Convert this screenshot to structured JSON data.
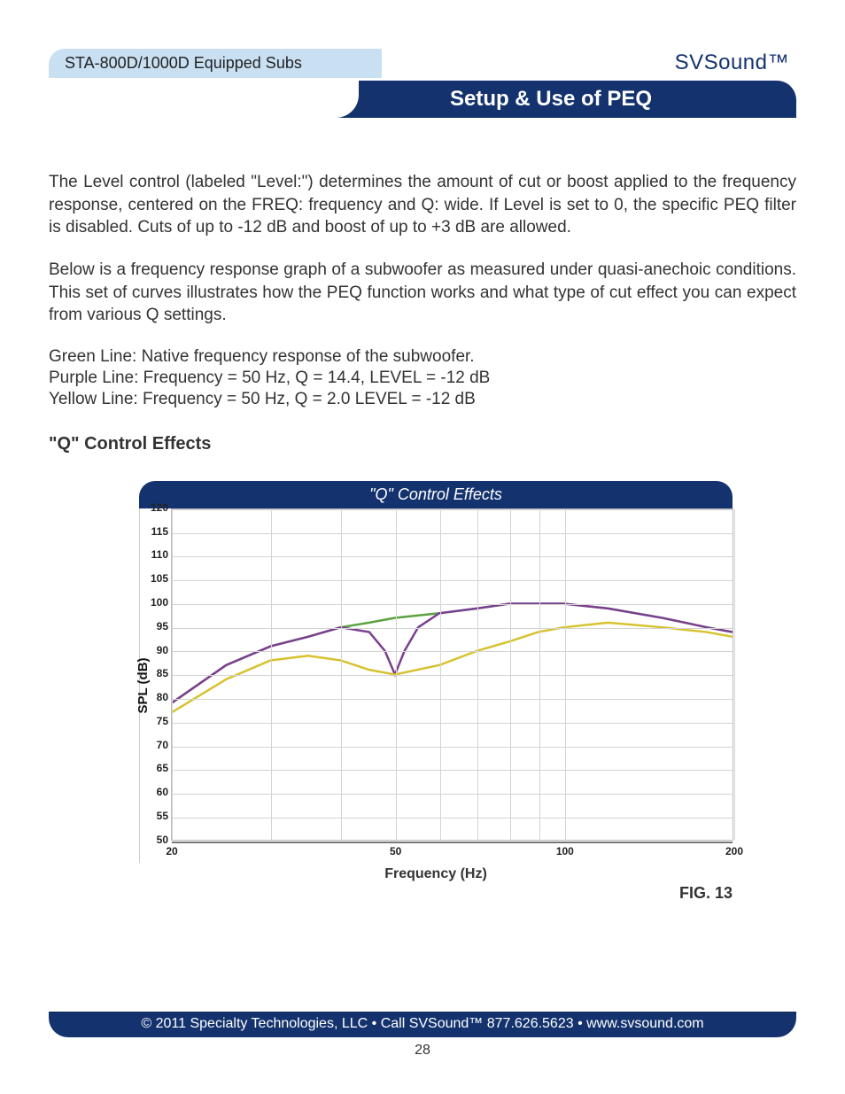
{
  "header": {
    "left_pill": "STA-800D/1000D Equipped Subs",
    "brand": "SVSound™",
    "section_title": "Setup & Use of PEQ"
  },
  "body": {
    "p1": "The Level control (labeled \"Level:\") determines the amount of cut or boost applied to the frequency response, centered on the FREQ: frequency and Q: wide. If Level is set to 0, the specific PEQ filter is disabled. Cuts of up to -12 dB and boost of up to +3 dB are allowed.",
    "p2": "Below is a frequency response graph of a subwoofer as measured under quasi-anechoic conditions. This set of curves illustrates how the PEQ function works and what type of cut effect you can expect from various Q settings.",
    "l1": "Green Line: Native frequency response of the subwoofer.",
    "l2": "Purple Line: Frequency = 50 Hz, Q = 14.4, LEVEL = -12 dB",
    "l3": "Yellow Line: Frequency = 50 Hz, Q = 2.0 LEVEL = -12 dB",
    "h3": "\"Q\" Control Effects"
  },
  "chart_data": {
    "type": "line",
    "title": "\"Q\" Control Effects",
    "xlabel": "Frequency (Hz)",
    "ylabel": "SPL (dB)",
    "xscale": "log",
    "xlim": [
      20,
      200
    ],
    "ylim": [
      50,
      120
    ],
    "yticks": [
      50,
      55,
      60,
      65,
      70,
      75,
      80,
      85,
      90,
      95,
      100,
      105,
      110,
      115,
      120
    ],
    "xticks": [
      20,
      50,
      100,
      200
    ],
    "series": [
      {
        "name": "Green — Native response",
        "color": "#5aa341",
        "x": [
          20,
          25,
          30,
          35,
          40,
          45,
          50,
          60,
          70,
          80,
          90,
          100,
          120,
          150,
          180,
          200
        ],
        "y": [
          79,
          87,
          91,
          93,
          95,
          96,
          97,
          98,
          99,
          100,
          100,
          100,
          99,
          97,
          95,
          94
        ]
      },
      {
        "name": "Purple — Q=14.4, -12 dB @ 50 Hz",
        "color": "#7a3f90",
        "x": [
          20,
          25,
          30,
          35,
          40,
          45,
          48,
          50,
          52,
          55,
          60,
          70,
          80,
          90,
          100,
          120,
          150,
          180,
          200
        ],
        "y": [
          79,
          87,
          91,
          93,
          95,
          94,
          90,
          85,
          90,
          95,
          98,
          99,
          100,
          100,
          100,
          99,
          97,
          95,
          94
        ]
      },
      {
        "name": "Yellow — Q=2.0, -12 dB @ 50 Hz",
        "color": "#d6c22e",
        "x": [
          20,
          25,
          30,
          35,
          40,
          45,
          50,
          60,
          70,
          80,
          90,
          100,
          120,
          150,
          180,
          200
        ],
        "y": [
          77,
          84,
          88,
          89,
          88,
          86,
          85,
          87,
          90,
          92,
          94,
          95,
          96,
          95,
          94,
          93
        ]
      }
    ]
  },
  "figure_label": "FIG. 13",
  "footer": {
    "text": "© 2011 Specialty Technologies, LLC   •   Call SVSound™ 877.626.5623   •   www.svsound.com",
    "page": "28"
  }
}
